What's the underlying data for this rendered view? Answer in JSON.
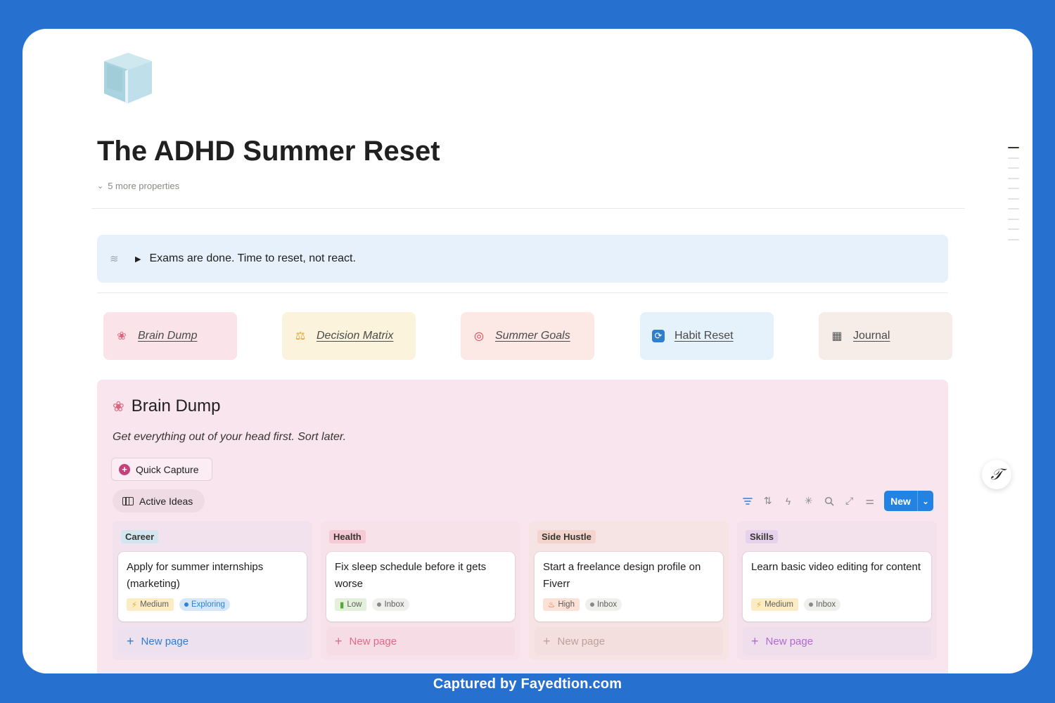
{
  "page": {
    "title": "The ADHD Summer Reset",
    "properties_toggle": "5 more properties",
    "icon": "ice-cube-icon"
  },
  "callout": {
    "text": "Exams are done. Time to reset, not react.",
    "icon": "wind-icon"
  },
  "nav_tiles": [
    {
      "label": "Brain Dump",
      "icon": "brain-icon",
      "glyph": "🧠",
      "bg": "#fae4ea"
    },
    {
      "label": "Decision Matrix",
      "icon": "scales-icon",
      "glyph": "⚖",
      "bg": "#fbf3dc"
    },
    {
      "label": "Summer Goals",
      "icon": "target-icon",
      "glyph": "◎",
      "bg": "#fce8e5"
    },
    {
      "label": "Habit Reset",
      "icon": "refresh-icon",
      "glyph": "⟳",
      "bg": "#e5f1fb"
    },
    {
      "label": "Journal",
      "icon": "notebook-icon",
      "glyph": "▦",
      "bg": "#f6ece8"
    }
  ],
  "brain_dump": {
    "title": "Brain Dump",
    "icon": "brain-icon",
    "subtitle": "Get everything out of your head first. Sort later.",
    "quick_capture_label": "Quick Capture",
    "view_label": "Active Ideas",
    "new_button_label": "New",
    "toolbar_icons": [
      "filter-icon",
      "sort-icon",
      "automation-icon",
      "sparkle-icon",
      "search-icon",
      "expand-icon",
      "settings-sliders-icon"
    ],
    "new_page_label": "New page",
    "columns": [
      {
        "group": "Career",
        "tag_bg": "#d3e5ef",
        "col_bg": "#f1e2ee",
        "newpage_color": "#2f7ccf",
        "newpage_bg": "#ede1f0",
        "card": {
          "title": "Apply for summer internships (marketing)",
          "tags": [
            {
              "label": "Medium",
              "glyph": "⚡",
              "kind": "prio",
              "bg": "#fbecc4",
              "color": "#e7a935"
            },
            {
              "label": "Exploring",
              "glyph": "",
              "kind": "status",
              "bg": "#d6e8f8",
              "color": "#2d80d6"
            }
          ]
        }
      },
      {
        "group": "Health",
        "tag_bg": "#f5cad6",
        "col_bg": "#f7e2ea",
        "newpage_color": "#df6b8a",
        "newpage_bg": "#f6dce5",
        "card": {
          "title": "Fix sleep schedule before it gets worse",
          "tags": [
            {
              "label": "Low",
              "glyph": "▮",
              "kind": "prio",
              "bg": "#e3f0da",
              "color": "#57a33d"
            },
            {
              "label": "Inbox",
              "glyph": "",
              "kind": "status",
              "bg": "#efefed",
              "color": "#8a8986"
            }
          ]
        }
      },
      {
        "group": "Side Hustle",
        "tag_bg": "#f3d5cd",
        "col_bg": "#f6e3e3",
        "newpage_color": "#b7a39b",
        "newpage_bg": "#f4dfdf",
        "card": {
          "title": "Start a freelance design profile on Fiverr",
          "tags": [
            {
              "label": "High",
              "glyph": "🔥",
              "kind": "prio",
              "bg": "#fce1d7",
              "color": "#e46b34"
            },
            {
              "label": "Inbox",
              "glyph": "",
              "kind": "status",
              "bg": "#efefed",
              "color": "#8a8986"
            }
          ]
        }
      },
      {
        "group": "Skills",
        "tag_bg": "#e6d2ec",
        "col_bg": "#f3e1ec",
        "newpage_color": "#b06ad0",
        "newpage_bg": "#efdeeb",
        "card": {
          "title": "Learn basic video editing for content",
          "tags": [
            {
              "label": "Medium",
              "glyph": "⚡",
              "kind": "prio",
              "bg": "#fbecc4",
              "color": "#e7a935"
            },
            {
              "label": "Inbox",
              "glyph": "",
              "kind": "status",
              "bg": "#efefed",
              "color": "#8a8986"
            }
          ]
        }
      }
    ]
  },
  "footer": {
    "caption": "Captured by Fayedtion.com"
  },
  "ai_button": {
    "icon": "notion-ai-icon",
    "glyph": "𝒯"
  }
}
